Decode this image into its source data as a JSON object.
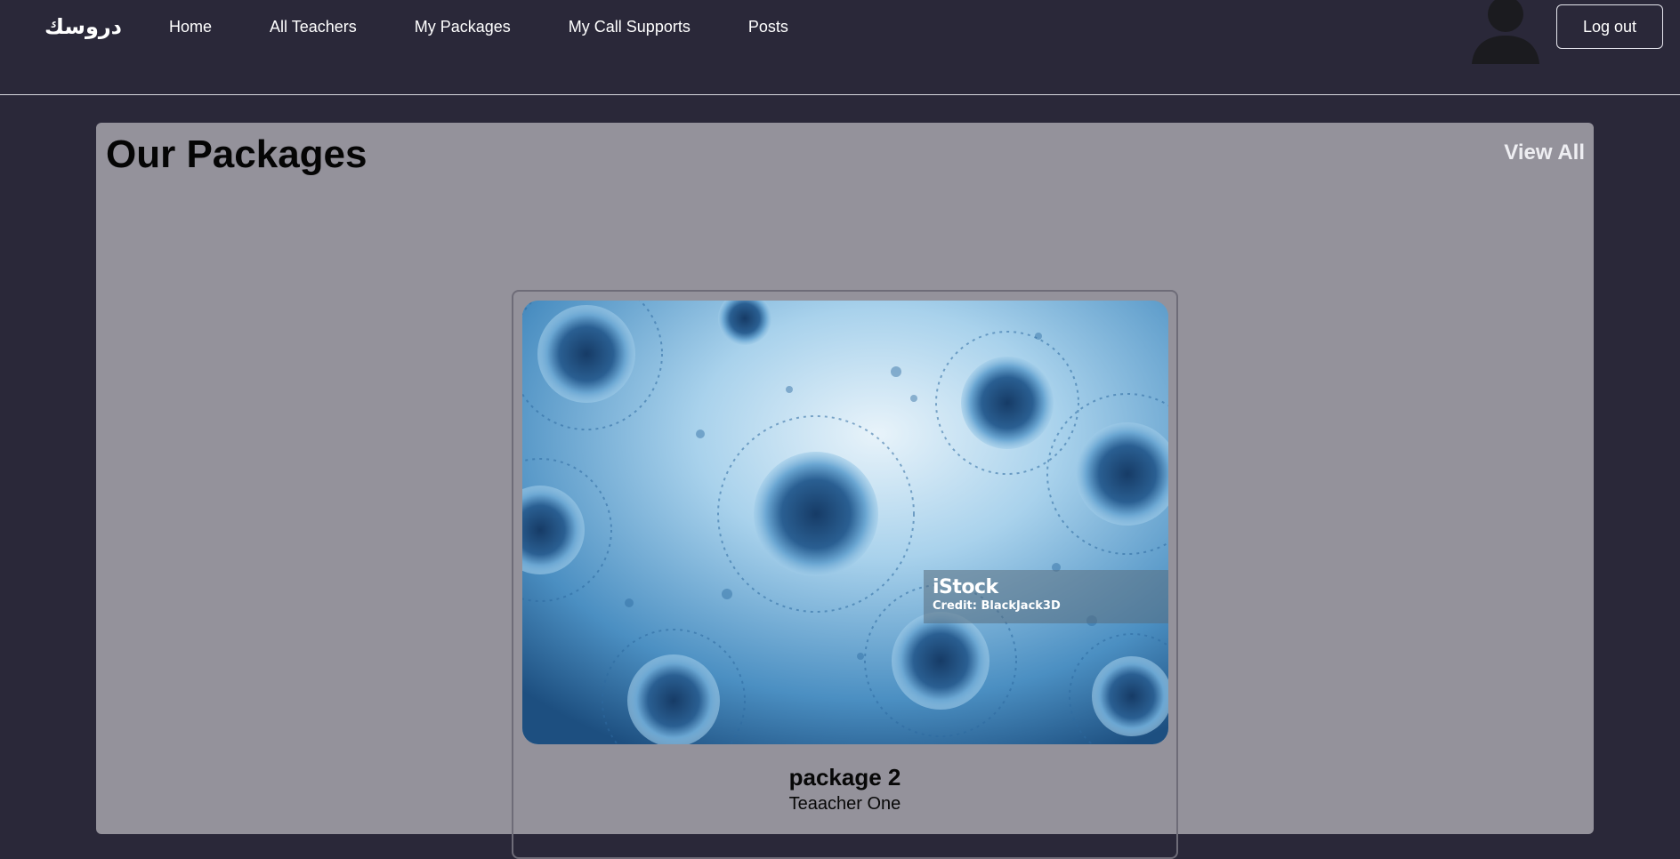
{
  "nav": {
    "brand": "دروسك",
    "links": [
      "Home",
      "All Teachers",
      "My Packages",
      "My Call Supports",
      "Posts"
    ],
    "logout_label": "Log out",
    "avatar_icon": "user-avatar-icon"
  },
  "packages_section": {
    "title": "Our Packages",
    "view_all_label": "View All",
    "cards": [
      {
        "name": "package 2",
        "teacher": "Teaacher One",
        "image_watermark": {
          "brand": "iStock",
          "credit": "Credit: BlackJack3D"
        }
      }
    ]
  },
  "colors": {
    "background": "#2a2839",
    "panel": "#94929b",
    "text_light": "#ffffff",
    "heading": "#050505"
  }
}
